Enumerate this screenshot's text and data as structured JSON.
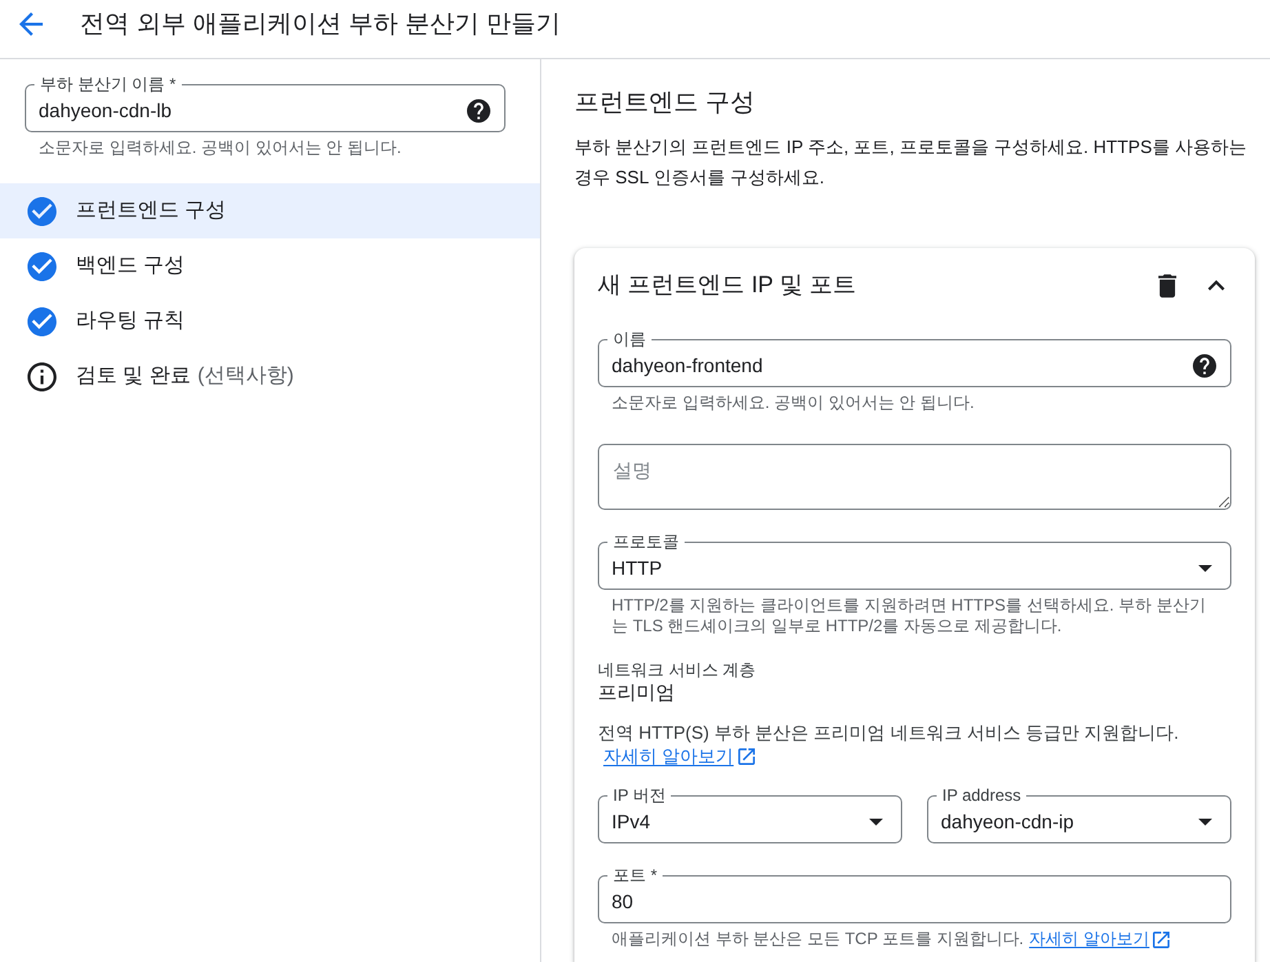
{
  "header": {
    "title": "전역 외부 애플리케이션 부하 분산기 만들기"
  },
  "sidebar": {
    "name_field": {
      "label": "부하 분산기 이름 *",
      "value": "dahyeon-cdn-lb",
      "help": true,
      "hint": {
        "text": "소문자로 입력하세요. 공백이 있어서는 안 됩니다."
      }
    },
    "steps": [
      {
        "label": "프런트엔드 구성",
        "done": true,
        "selected": true
      },
      {
        "label": "백엔드 구성",
        "done": true,
        "selected": false
      },
      {
        "label": "라우팅 규칙",
        "done": true,
        "selected": false
      },
      {
        "label": "검토 및 완료",
        "note": "(선택사항)",
        "done": false,
        "selected": false
      }
    ]
  },
  "main": {
    "heading": "프런트엔드 구성",
    "description": "부하 분산기의 프런트엔드 IP 주소, 포트, 프로토콜을 구성하세요. HTTPS를 사용하는 경우 SSL 인증서를 구성하세요.",
    "card": {
      "title": "새 프런트엔드 IP 및 포트",
      "expanded": true,
      "items": [
        {
          "kind": "text",
          "label": "이름",
          "value": "dahyeon-frontend",
          "help": true,
          "hint": {
            "text": "소문자로 입력하세요. 공백이 있어서는 안 됩니다."
          }
        },
        {
          "kind": "textarea",
          "placeholder": "설명"
        },
        {
          "kind": "select",
          "label": "프로토콜",
          "value": "HTTP",
          "hint": {
            "text": "HTTP/2를 지원하는 클라이언트를 지원하려면 HTTPS를 선택하세요. 부하 분산기는 TLS 핸드셰이크의 일부로 HTTP/2를 자동으로 제공합니다."
          }
        },
        {
          "kind": "readonly",
          "label": "네트워크 서비스 계층",
          "value": "프리미엄"
        },
        {
          "kind": "notice",
          "text": "전역 HTTP(S) 부하 분산은 프리미엄 네트워크 서비스 등급만 지원합니다.",
          "link": "자세히 알아보기"
        },
        {
          "kind": "select_pair",
          "selects": [
            {
              "label": "IP 버전",
              "value": "IPv4"
            },
            {
              "label": "IP address",
              "value": "dahyeon-cdn-ip"
            }
          ]
        },
        {
          "kind": "text",
          "label": "포트 *",
          "value": "80",
          "hint": {
            "text": "애플리케이션 부하 분산은 모든 TCP 포트를 지원합니다.",
            "link": "자세히 알아보기"
          }
        }
      ]
    }
  }
}
